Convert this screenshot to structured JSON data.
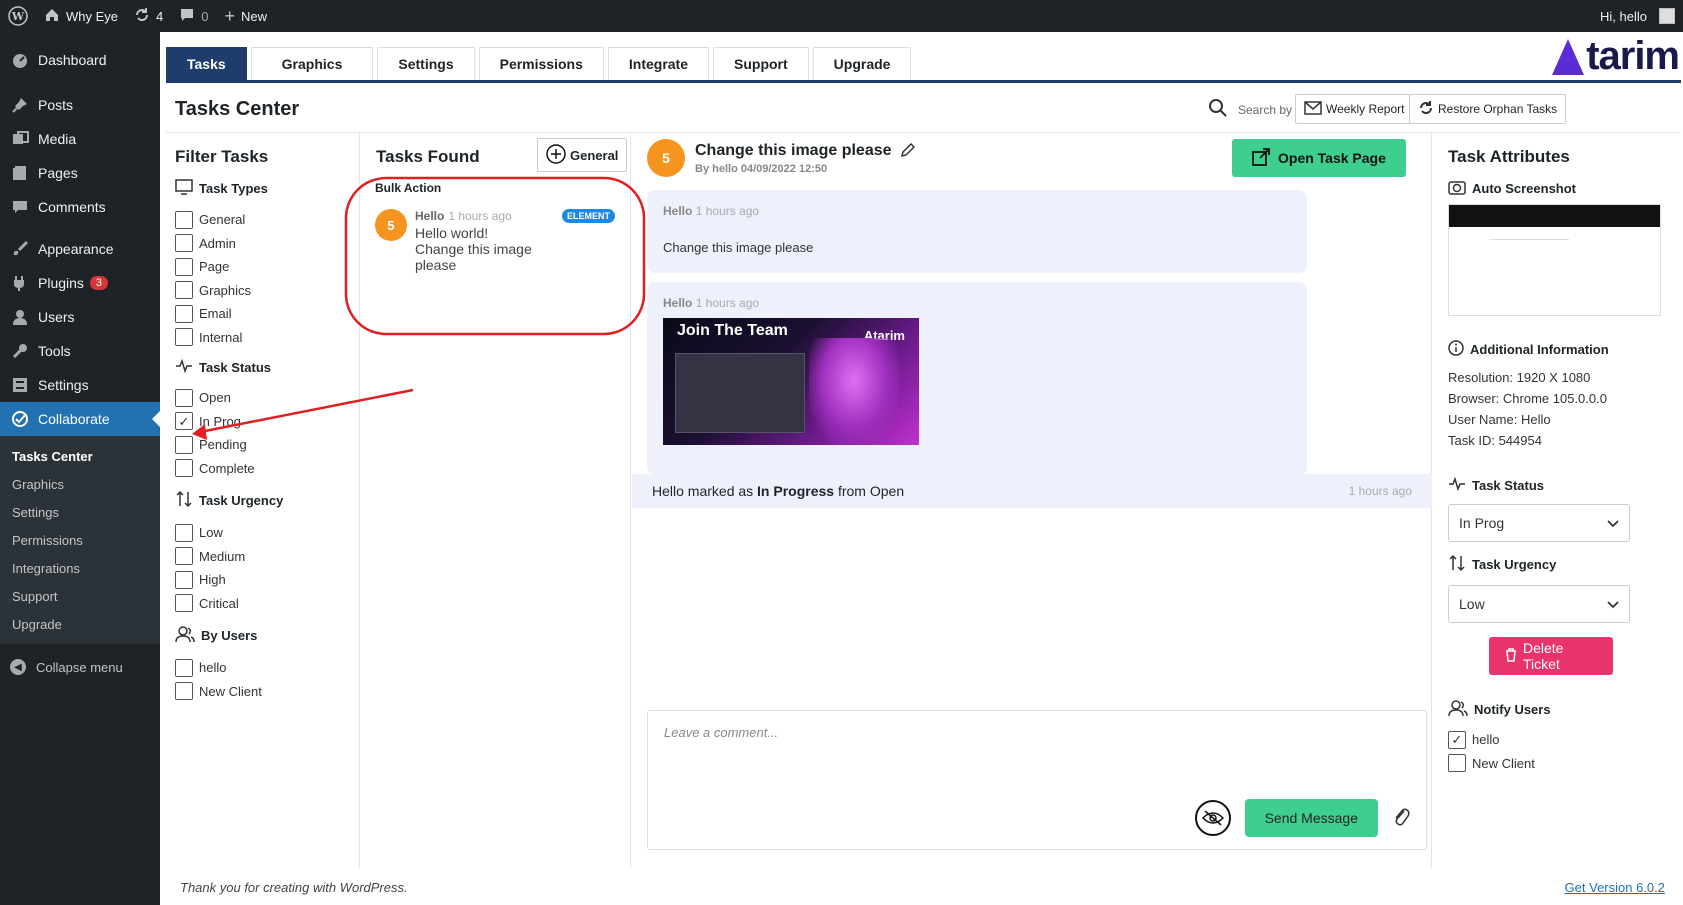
{
  "admin_bar": {
    "site_name": "Why Eye",
    "updates_count": "4",
    "comments_count": "0",
    "new_label": "New",
    "greeting": "Hi, hello"
  },
  "sidebar": {
    "items": [
      {
        "label": "Dashboard",
        "icon": "dashboard-icon"
      },
      {
        "label": "Posts",
        "icon": "pin-icon"
      },
      {
        "label": "Media",
        "icon": "media-icon"
      },
      {
        "label": "Pages",
        "icon": "pages-icon"
      },
      {
        "label": "Comments",
        "icon": "comments-icon"
      },
      {
        "label": "Appearance",
        "icon": "brush-icon"
      },
      {
        "label": "Plugins",
        "icon": "plugin-icon",
        "badge": "3"
      },
      {
        "label": "Users",
        "icon": "users-icon"
      },
      {
        "label": "Tools",
        "icon": "wrench-icon"
      },
      {
        "label": "Settings",
        "icon": "settings-icon"
      },
      {
        "label": "Collaborate",
        "icon": "check-circle-icon"
      }
    ],
    "submenu": [
      "Tasks Center",
      "Graphics",
      "Settings",
      "Permissions",
      "Integrations",
      "Support",
      "Upgrade"
    ],
    "collapse_label": "Collapse menu"
  },
  "tabs": [
    "Tasks",
    "Graphics",
    "Settings",
    "Permissions",
    "Integrate",
    "Support",
    "Upgrade"
  ],
  "logo_text": "tarim",
  "header": {
    "title": "Tasks Center",
    "search_placeholder": "Search by task title",
    "weekly_report": "Weekly Report",
    "restore_orphan": "Restore Orphan Tasks"
  },
  "filters": {
    "title": "Filter Tasks",
    "task_types_title": "Task Types",
    "task_types": [
      "General",
      "Admin",
      "Page",
      "Graphics",
      "Email",
      "Internal"
    ],
    "task_status_title": "Task Status",
    "task_status": [
      "Open",
      "In Prog",
      "Pending",
      "Complete"
    ],
    "task_status_checked": [
      false,
      true,
      false,
      false
    ],
    "urgency_title": "Task Urgency",
    "urgency": [
      "Low",
      "Medium",
      "High",
      "Critical"
    ],
    "users_title": "By Users",
    "users": [
      "hello",
      "New Client"
    ]
  },
  "tasks_found": {
    "title": "Tasks Found",
    "general_btn": "General",
    "bulk_action": "Bulk Action",
    "card": {
      "number": "5",
      "author": "Hello",
      "time": "1 hours ago",
      "badge": "ELEMENT",
      "line1": "Hello world!",
      "line2": "Change this image",
      "line3": "please"
    }
  },
  "task_detail": {
    "number": "5",
    "title": "Change this image please",
    "meta": "By hello 04/09/2022 12:50",
    "open_task_btn": "Open Task Page",
    "msg1": {
      "author": "Hello",
      "time": "1 hours ago",
      "text": "Change this image please"
    },
    "msg2": {
      "author": "Hello",
      "time": "1 hours ago",
      "image_heading": "Join The Team",
      "image_logo": "Atarim"
    },
    "status_change": {
      "prefix": "Hello marked as",
      "status": "In Progress",
      "suffix": "from Open",
      "time": "1 hours ago"
    },
    "comment_placeholder": "Leave a comment...",
    "send_btn": "Send Message"
  },
  "attributes": {
    "title": "Task Attributes",
    "auto_screenshot": "Auto Screenshot",
    "additional_info_title": "Additional Information",
    "resolution": "Resolution: 1920 X 1080",
    "browser": "Browser: Chrome 105.0.0.0",
    "user_name": "User Name: Hello",
    "task_id": "Task ID: 544954",
    "task_status_label": "Task Status",
    "task_status_value": "In Prog",
    "task_urgency_label": "Task Urgency",
    "task_urgency_value": "Low",
    "delete_btn": "Delete Ticket",
    "notify_title": "Notify Users",
    "notify_users": [
      "hello",
      "New Client"
    ],
    "notify_checked": [
      true,
      false
    ]
  },
  "footer": {
    "left": "Thank you for creating with WordPress.",
    "right": "Get Version 6.0.2"
  },
  "colors": {
    "accent_blue": "#1e3d6b",
    "green": "#3ecf8e",
    "pink": "#e8336b",
    "orange": "#f7941d",
    "wp_blue": "#2271b1"
  }
}
